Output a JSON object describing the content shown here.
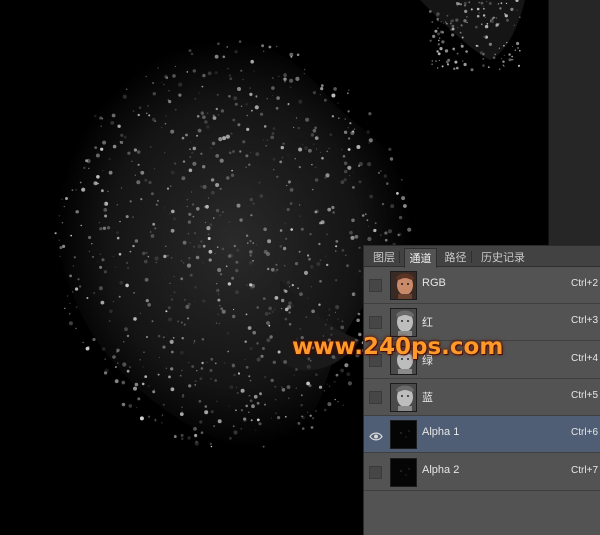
{
  "watermark": "www.240ps.com",
  "panel": {
    "tabs": [
      "图层",
      "通道",
      "路径",
      "历史记录"
    ],
    "active_tab": "通道",
    "channels": [
      {
        "name": "RGB",
        "shortcut": "Ctrl+2",
        "visible": false,
        "selected": false,
        "thumb": "color-face"
      },
      {
        "name": "红",
        "shortcut": "Ctrl+3",
        "visible": false,
        "selected": false,
        "thumb": "gray-face"
      },
      {
        "name": "绿",
        "shortcut": "Ctrl+4",
        "visible": false,
        "selected": false,
        "thumb": "gray-face"
      },
      {
        "name": "蓝",
        "shortcut": "Ctrl+5",
        "visible": false,
        "selected": false,
        "thumb": "gray-face"
      },
      {
        "name": "Alpha 1",
        "shortcut": "Ctrl+6",
        "visible": true,
        "selected": true,
        "thumb": "dark-mask"
      },
      {
        "name": "Alpha 2",
        "shortcut": "Ctrl+7",
        "visible": false,
        "selected": false,
        "thumb": "dark-mask"
      }
    ]
  },
  "colors": {
    "canvas": "#000000",
    "panel_bg": "#535353",
    "selected_row": "#4f5e74",
    "watermark": "#ff9a2a"
  }
}
